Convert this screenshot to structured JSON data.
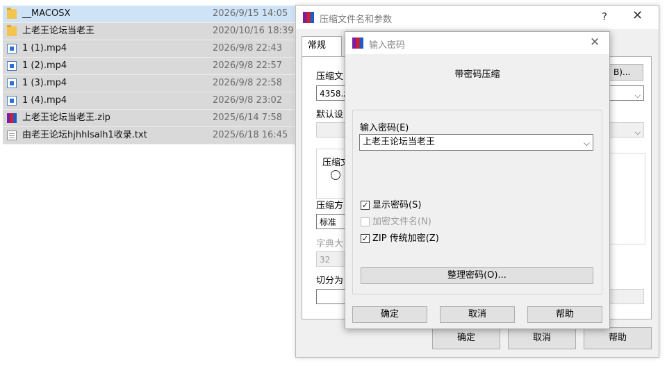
{
  "file_list": [
    {
      "name": "__MACOSX",
      "date": "2026/9/15 14:05",
      "icon": "folder-icon"
    },
    {
      "name": "上老王论坛当老王",
      "date": "2020/10/16 18:39",
      "icon": "folder-icon"
    },
    {
      "name": "1 (1).mp4",
      "date": "2026/9/8 22:43",
      "icon": "video-file-icon"
    },
    {
      "name": "1 (2).mp4",
      "date": "2026/9/8 22:57",
      "icon": "video-file-icon"
    },
    {
      "name": "1 (3).mp4",
      "date": "2026/9/8 22:58",
      "icon": "video-file-icon"
    },
    {
      "name": "1 (4).mp4",
      "date": "2026/9/8 23:02",
      "icon": "video-file-icon"
    },
    {
      "name": "上老王论坛当老王.zip",
      "date": "2025/6/14 7:58",
      "icon": "winrar-archive-icon"
    },
    {
      "name": "由老王论坛hjhhlsalh1收录.txt",
      "date": "2025/6/18 16:45",
      "icon": "text-file-icon"
    }
  ],
  "archive_dialog": {
    "title": "压缩文件名和参数",
    "help": "?",
    "close": "✕",
    "tab_general": "常规",
    "archive_name_label": "压缩文",
    "browse_label": "B)...",
    "archive_name_value": "4358.z",
    "profile_label": "默认设",
    "format_label": "压缩文",
    "method_label": "压缩方",
    "method_value": "标准",
    "dict_label": "字典大",
    "dict_value": "32",
    "split_label": "切分为",
    "ok": "确定",
    "cancel": "取消",
    "help_button": "帮助"
  },
  "password_dialog": {
    "title": "输入密码",
    "close": "✕",
    "heading": "带密码压缩",
    "password_label": "输入密码(E)",
    "password_value": "上老王论坛当老王",
    "show_password": {
      "label": "显示密码(S)",
      "checked": true
    },
    "encrypt_filenames": {
      "label": "加密文件名(N)",
      "checked": false,
      "disabled": true
    },
    "zip_legacy": {
      "label": "ZIP 传统加密(Z)",
      "checked": true
    },
    "organize_button": "整理密码(O)...",
    "ok": "确定",
    "cancel": "取消",
    "help": "帮助"
  }
}
